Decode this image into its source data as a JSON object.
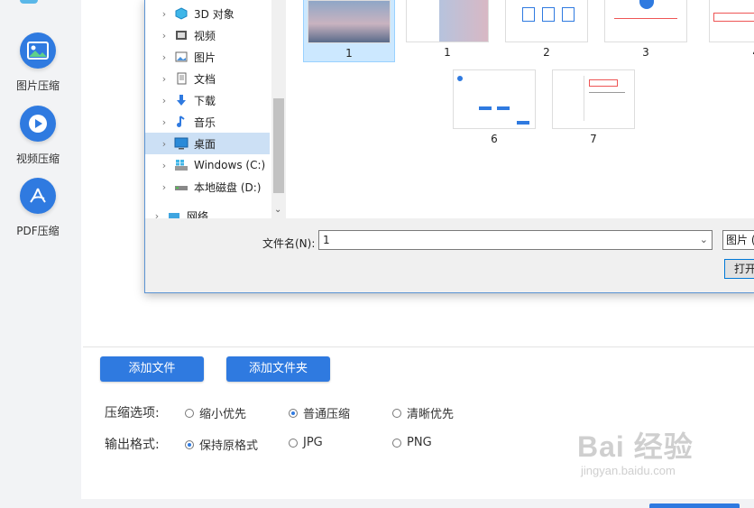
{
  "sidebar": {
    "tools": [
      {
        "label": "图片压缩",
        "icon": "image-icon"
      },
      {
        "label": "视频压缩",
        "icon": "play-icon"
      },
      {
        "label": "PDF压缩",
        "icon": "pdf-icon"
      }
    ]
  },
  "dialog": {
    "nav_items": [
      {
        "label": "3D 对象",
        "icon": "cube-icon"
      },
      {
        "label": "视频",
        "icon": "video-folder-icon"
      },
      {
        "label": "图片",
        "icon": "pictures-folder-icon"
      },
      {
        "label": "文档",
        "icon": "documents-folder-icon"
      },
      {
        "label": "下载",
        "icon": "download-arrow-icon"
      },
      {
        "label": "音乐",
        "icon": "music-note-icon"
      },
      {
        "label": "桌面",
        "icon": "desktop-icon",
        "selected": true
      },
      {
        "label": "Windows (C:)",
        "icon": "windows-drive-icon"
      },
      {
        "label": "本地磁盘 (D:)",
        "icon": "disk-drive-icon"
      },
      {
        "label": "网络",
        "icon": "network-icon"
      }
    ],
    "files": [
      {
        "name": "1"
      },
      {
        "name": "1"
      },
      {
        "name": "2"
      },
      {
        "name": "3"
      },
      {
        "name": "4"
      },
      {
        "name": "6"
      },
      {
        "name": "7"
      }
    ],
    "filename_label": "文件名(N):",
    "filename_value": "1",
    "filetype_value": "图片 (",
    "open_label": "打开"
  },
  "actions": {
    "add_file": "添加文件",
    "add_folder": "添加文件夹"
  },
  "compress_options": {
    "label": "压缩选项:",
    "options": [
      {
        "label": "缩小优先",
        "checked": false
      },
      {
        "label": "普通压缩",
        "checked": true
      },
      {
        "label": "清晰优先",
        "checked": false
      }
    ]
  },
  "output_format": {
    "label": "输出格式:",
    "options": [
      {
        "label": "保持原格式",
        "checked": true
      },
      {
        "label": "JPG",
        "checked": false
      },
      {
        "label": "PNG",
        "checked": false
      }
    ]
  },
  "watermark": {
    "big": "Bai 经验",
    "small": "jingyan.baidu.com"
  },
  "colors": {
    "accent": "#2f7ae0",
    "selection": "#cce8ff"
  }
}
